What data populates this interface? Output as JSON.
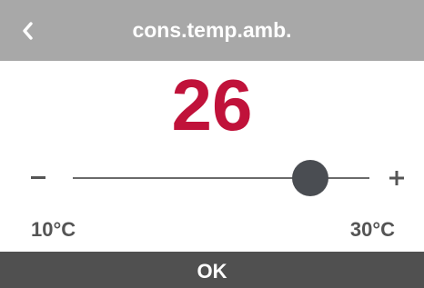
{
  "header": {
    "title": "cons.temp.amb.",
    "back_icon": "chevron-left-icon"
  },
  "setpoint": {
    "value": "26",
    "value_color": "#c0123a",
    "min_label": "10°C",
    "max_label": "30°C",
    "slider": {
      "min": 10,
      "max": 30,
      "current": 26
    }
  },
  "controls": {
    "minus_label": "–",
    "plus_label": "+"
  },
  "footer": {
    "ok_label": "OK"
  },
  "colors": {
    "header_bg": "#a8a8a8",
    "footer_bg": "#505050",
    "thumb": "#4a4d52"
  }
}
